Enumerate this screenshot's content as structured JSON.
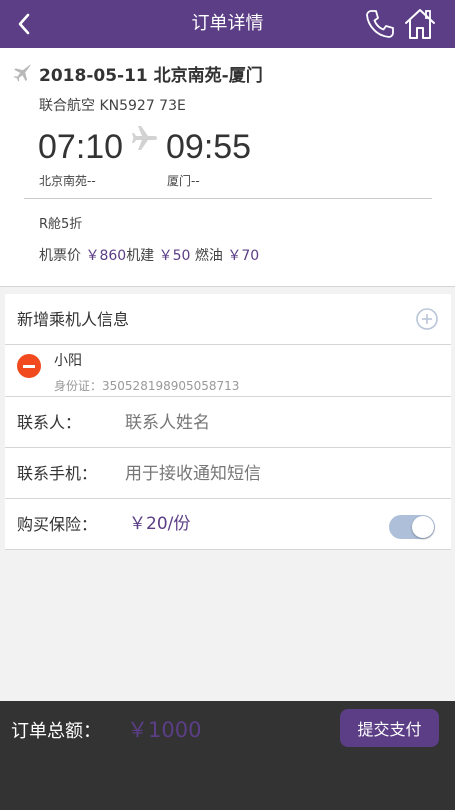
{
  "header": {
    "title": "订单详情",
    "icons": {
      "back": "back-arrow-icon",
      "phone": "phone-icon",
      "home": "home-icon"
    }
  },
  "flight": {
    "route": "2018-05-11 北京南苑-厦门",
    "airline": "联合航空 KN5927 73E",
    "departure_time": "07:10",
    "arrival_time": "09:55",
    "departure_city": "北京南苑--",
    "arrival_city": "厦门--",
    "cabin": "R舱5折",
    "ticket_label": "机票价",
    "ticket_price": "￥860",
    "construction_label": "机建",
    "construction_price": "￥50",
    "fuel_label": "燃油",
    "fuel_price": "￥70"
  },
  "passenger_section": {
    "add_label": "新增乘机人信息",
    "passengers": [
      {
        "name": "小阳",
        "id_label": "身份证：",
        "id_number": "350528198905058713"
      }
    ]
  },
  "contact": {
    "name_label": "联系人：",
    "name_placeholder": "联系人姓名",
    "phone_label": "联系手机：",
    "phone_placeholder": "用于接收通知短信"
  },
  "insurance": {
    "label": "购买保险：",
    "price": "￥20/份",
    "enabled": true
  },
  "footer": {
    "total_label": "订单总额：",
    "total_value": "￥1000",
    "pay_label": "提交支付"
  },
  "colors": {
    "brand": "#5b3e86",
    "remove": "#f24a1f",
    "footer_bg": "#333333",
    "toggle_track": "#aebfd9"
  }
}
